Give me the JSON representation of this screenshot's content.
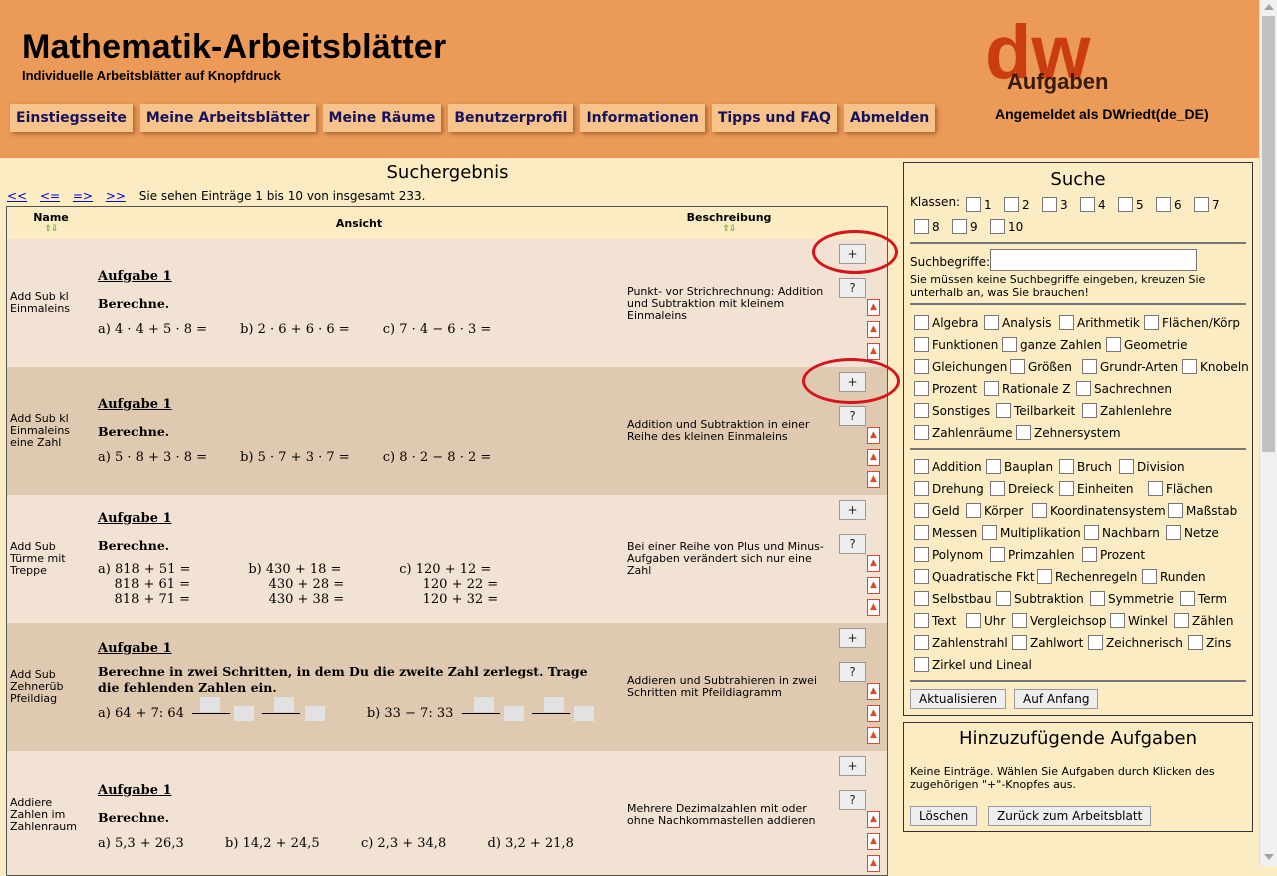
{
  "header": {
    "title": "Mathematik-Arbeitsblätter",
    "subtitle": "Individuelle Arbeitsblätter auf Knopfdruck",
    "logo_text": "dw",
    "logo_sub": "Aufgaben",
    "logged_in": "Angemeldet als DWriedt(de_DE)",
    "nav": [
      "Einstiegsseite",
      "Meine Arbeitsblätter",
      "Meine Räume",
      "Benutzerprofil",
      "Informationen",
      "Tipps und FAQ",
      "Abmelden"
    ]
  },
  "results": {
    "heading": "Suchergebnis",
    "pager": [
      "<<",
      "<=",
      "=>",
      ">>"
    ],
    "info": "Sie sehen Einträge 1 bis 10 von insgesamt 233.",
    "columns": [
      "Name",
      "Ansicht",
      "Beschreibung"
    ],
    "plus_label": "+",
    "help_label": "?",
    "rows": [
      {
        "name": "Add Sub kl Einmaleins",
        "task_title": "Aufgabe 1",
        "instruction": "Berechne.",
        "lines": [
          "a) 4 · 4 + 5 · 8 =        b) 2 · 6 + 6 · 6 =        c) 7 · 4 − 6 · 3 ="
        ],
        "description": "Punkt- vor Strichrechnung: Addition und Subtraktion mit kleinem Einmaleins"
      },
      {
        "name": "Add Sub kl Einmaleins eine Zahl",
        "task_title": "Aufgabe 1",
        "instruction": "Berechne.",
        "lines": [
          "a) 5 · 8 + 3 · 8 =        b) 5 · 7 + 3 · 7 =        c) 8 · 2 − 8 · 2 ="
        ],
        "description": "Addition und Subtraktion in einer Reihe des kleinen Einmaleins"
      },
      {
        "name": "Add Sub Türme mit Treppe",
        "task_title": "Aufgabe 1",
        "instruction": "Berechne.",
        "lines": [
          "a) 818 + 51 =              b) 430 + 18 =              c) 120 + 12 =",
          "    818 + 61 =                   430 + 28 =                   120 + 22 =",
          "    818 + 71 =                   430 + 38 =                   120 + 32 ="
        ],
        "description": "Bei einer Reihe von Plus und Minus-Aufgaben verändert sich nur eine Zahl"
      },
      {
        "name": "Add Sub Zehnerüb Pfeildiag",
        "task_title": "Aufgabe 1",
        "instruction": "Berechne in zwei Schritten, in dem Du die zweite Zahl zerlegst. Trage die fehlenden Zahlen ein.",
        "lines": [
          "a) 64 + 7:   64",
          "b) 33 − 7:   33"
        ],
        "description": "Addieren und Subtrahieren in zwei Schritten mit Pfeildiagramm"
      },
      {
        "name": "Addiere Zahlen im Zahlenraum",
        "task_title": "Aufgabe 1",
        "instruction": "Berechne.",
        "lines": [
          "a) 5,3 + 26,3          b) 14,2 + 24,5          c) 2,3 + 34,8          d) 3,2 + 21,8"
        ],
        "description": "Mehrere Dezimalzahlen mit oder ohne Nachkommastellen addieren"
      }
    ]
  },
  "search": {
    "title": "Suche",
    "classes_label": "Klassen:",
    "classes": [
      "1",
      "2",
      "3",
      "4",
      "5",
      "6",
      "7",
      "8",
      "9",
      "10"
    ],
    "terms_label": "Suchbegriffe:",
    "terms_value": "",
    "hint": "Sie müssen keine Suchbegriffe eingeben, kreuzen Sie unterhalb an, was Sie brauchen!",
    "topics1": [
      "Algebra",
      "Analysis",
      "Arithmetik",
      "Flächen/Körp",
      "Funktionen",
      "ganze Zahlen",
      "Geometrie",
      "Gleichungen",
      "Größen",
      "Grundr-Arten",
      "Knobeln",
      "Prozent",
      "Rationale Z",
      "Sachrechnen",
      "Sonstiges",
      "Teilbarkeit",
      "Zahlenlehre",
      "Zahlenräume",
      "Zehnersystem"
    ],
    "topics2": [
      "Addition",
      "Bauplan",
      "Bruch",
      "Division",
      "Drehung",
      "Dreieck",
      "Einheiten",
      "Flächen",
      "Geld",
      "Körper",
      "Koordinatensystem",
      "Maßstab",
      "Messen",
      "Multiplikation",
      "Nachbarn",
      "Netze",
      "Polynom",
      "Primzahlen",
      "Prozent",
      "Quadratische Fkt",
      "Rechenregeln",
      "Runden",
      "Selbstbau",
      "Subtraktion",
      "Symmetrie",
      "Term",
      "Text",
      "Uhr",
      "Vergleichsop",
      "Winkel",
      "Zählen",
      "Zahlenstrahl",
      "Zahlwort",
      "Zeichnerisch",
      "Zins",
      "Zirkel und Lineal"
    ],
    "update_label": "Aktualisieren",
    "reset_label": "Auf Anfang"
  },
  "pending": {
    "title": "Hinzuzufügende Aufgaben",
    "text": "Keine Einträge. Wählen Sie Aufgaben durch Klicken des zugehörigen \"+\"-Knopfes aus.",
    "delete_label": "Löschen",
    "back_label": "Zurück zum Arbeitsblatt"
  },
  "colors": {
    "header_bg": "#ec9a58",
    "page_bg": "#fbecc4",
    "nav_bg": "#f7c38a",
    "nav_text": "#16125e",
    "row_light": "#f2e2d4",
    "row_dark": "#dfc9b0",
    "logo": "#c93d10",
    "annotation": "#d6141c"
  }
}
